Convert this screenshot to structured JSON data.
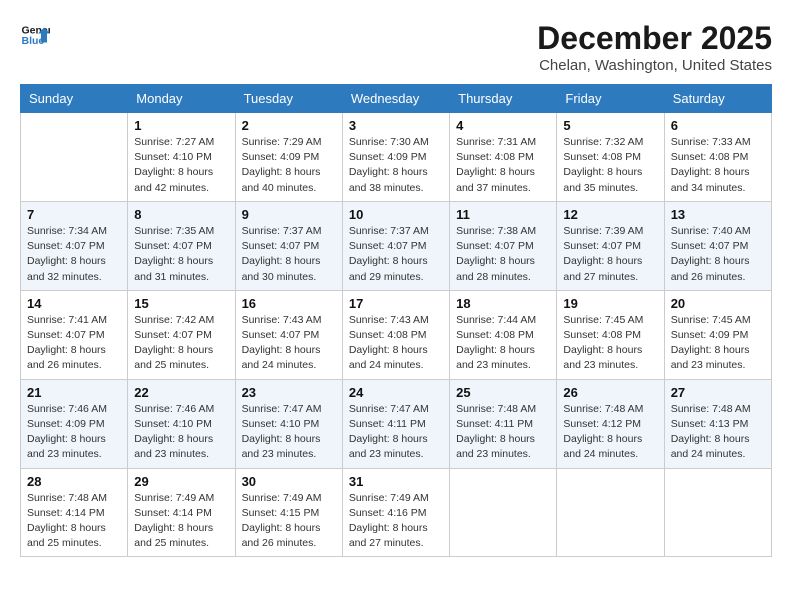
{
  "logo": {
    "line1": "General",
    "line2": "Blue"
  },
  "title": "December 2025",
  "location": "Chelan, Washington, United States",
  "days_header": [
    "Sunday",
    "Monday",
    "Tuesday",
    "Wednesday",
    "Thursday",
    "Friday",
    "Saturday"
  ],
  "weeks": [
    [
      {
        "day": "",
        "info": ""
      },
      {
        "day": "1",
        "info": "Sunrise: 7:27 AM\nSunset: 4:10 PM\nDaylight: 8 hours\nand 42 minutes."
      },
      {
        "day": "2",
        "info": "Sunrise: 7:29 AM\nSunset: 4:09 PM\nDaylight: 8 hours\nand 40 minutes."
      },
      {
        "day": "3",
        "info": "Sunrise: 7:30 AM\nSunset: 4:09 PM\nDaylight: 8 hours\nand 38 minutes."
      },
      {
        "day": "4",
        "info": "Sunrise: 7:31 AM\nSunset: 4:08 PM\nDaylight: 8 hours\nand 37 minutes."
      },
      {
        "day": "5",
        "info": "Sunrise: 7:32 AM\nSunset: 4:08 PM\nDaylight: 8 hours\nand 35 minutes."
      },
      {
        "day": "6",
        "info": "Sunrise: 7:33 AM\nSunset: 4:08 PM\nDaylight: 8 hours\nand 34 minutes."
      }
    ],
    [
      {
        "day": "7",
        "info": "Sunrise: 7:34 AM\nSunset: 4:07 PM\nDaylight: 8 hours\nand 32 minutes."
      },
      {
        "day": "8",
        "info": "Sunrise: 7:35 AM\nSunset: 4:07 PM\nDaylight: 8 hours\nand 31 minutes."
      },
      {
        "day": "9",
        "info": "Sunrise: 7:37 AM\nSunset: 4:07 PM\nDaylight: 8 hours\nand 30 minutes."
      },
      {
        "day": "10",
        "info": "Sunrise: 7:37 AM\nSunset: 4:07 PM\nDaylight: 8 hours\nand 29 minutes."
      },
      {
        "day": "11",
        "info": "Sunrise: 7:38 AM\nSunset: 4:07 PM\nDaylight: 8 hours\nand 28 minutes."
      },
      {
        "day": "12",
        "info": "Sunrise: 7:39 AM\nSunset: 4:07 PM\nDaylight: 8 hours\nand 27 minutes."
      },
      {
        "day": "13",
        "info": "Sunrise: 7:40 AM\nSunset: 4:07 PM\nDaylight: 8 hours\nand 26 minutes."
      }
    ],
    [
      {
        "day": "14",
        "info": "Sunrise: 7:41 AM\nSunset: 4:07 PM\nDaylight: 8 hours\nand 26 minutes."
      },
      {
        "day": "15",
        "info": "Sunrise: 7:42 AM\nSunset: 4:07 PM\nDaylight: 8 hours\nand 25 minutes."
      },
      {
        "day": "16",
        "info": "Sunrise: 7:43 AM\nSunset: 4:07 PM\nDaylight: 8 hours\nand 24 minutes."
      },
      {
        "day": "17",
        "info": "Sunrise: 7:43 AM\nSunset: 4:08 PM\nDaylight: 8 hours\nand 24 minutes."
      },
      {
        "day": "18",
        "info": "Sunrise: 7:44 AM\nSunset: 4:08 PM\nDaylight: 8 hours\nand 23 minutes."
      },
      {
        "day": "19",
        "info": "Sunrise: 7:45 AM\nSunset: 4:08 PM\nDaylight: 8 hours\nand 23 minutes."
      },
      {
        "day": "20",
        "info": "Sunrise: 7:45 AM\nSunset: 4:09 PM\nDaylight: 8 hours\nand 23 minutes."
      }
    ],
    [
      {
        "day": "21",
        "info": "Sunrise: 7:46 AM\nSunset: 4:09 PM\nDaylight: 8 hours\nand 23 minutes."
      },
      {
        "day": "22",
        "info": "Sunrise: 7:46 AM\nSunset: 4:10 PM\nDaylight: 8 hours\nand 23 minutes."
      },
      {
        "day": "23",
        "info": "Sunrise: 7:47 AM\nSunset: 4:10 PM\nDaylight: 8 hours\nand 23 minutes."
      },
      {
        "day": "24",
        "info": "Sunrise: 7:47 AM\nSunset: 4:11 PM\nDaylight: 8 hours\nand 23 minutes."
      },
      {
        "day": "25",
        "info": "Sunrise: 7:48 AM\nSunset: 4:11 PM\nDaylight: 8 hours\nand 23 minutes."
      },
      {
        "day": "26",
        "info": "Sunrise: 7:48 AM\nSunset: 4:12 PM\nDaylight: 8 hours\nand 24 minutes."
      },
      {
        "day": "27",
        "info": "Sunrise: 7:48 AM\nSunset: 4:13 PM\nDaylight: 8 hours\nand 24 minutes."
      }
    ],
    [
      {
        "day": "28",
        "info": "Sunrise: 7:48 AM\nSunset: 4:14 PM\nDaylight: 8 hours\nand 25 minutes."
      },
      {
        "day": "29",
        "info": "Sunrise: 7:49 AM\nSunset: 4:14 PM\nDaylight: 8 hours\nand 25 minutes."
      },
      {
        "day": "30",
        "info": "Sunrise: 7:49 AM\nSunset: 4:15 PM\nDaylight: 8 hours\nand 26 minutes."
      },
      {
        "day": "31",
        "info": "Sunrise: 7:49 AM\nSunset: 4:16 PM\nDaylight: 8 hours\nand 27 minutes."
      },
      {
        "day": "",
        "info": ""
      },
      {
        "day": "",
        "info": ""
      },
      {
        "day": "",
        "info": ""
      }
    ]
  ]
}
